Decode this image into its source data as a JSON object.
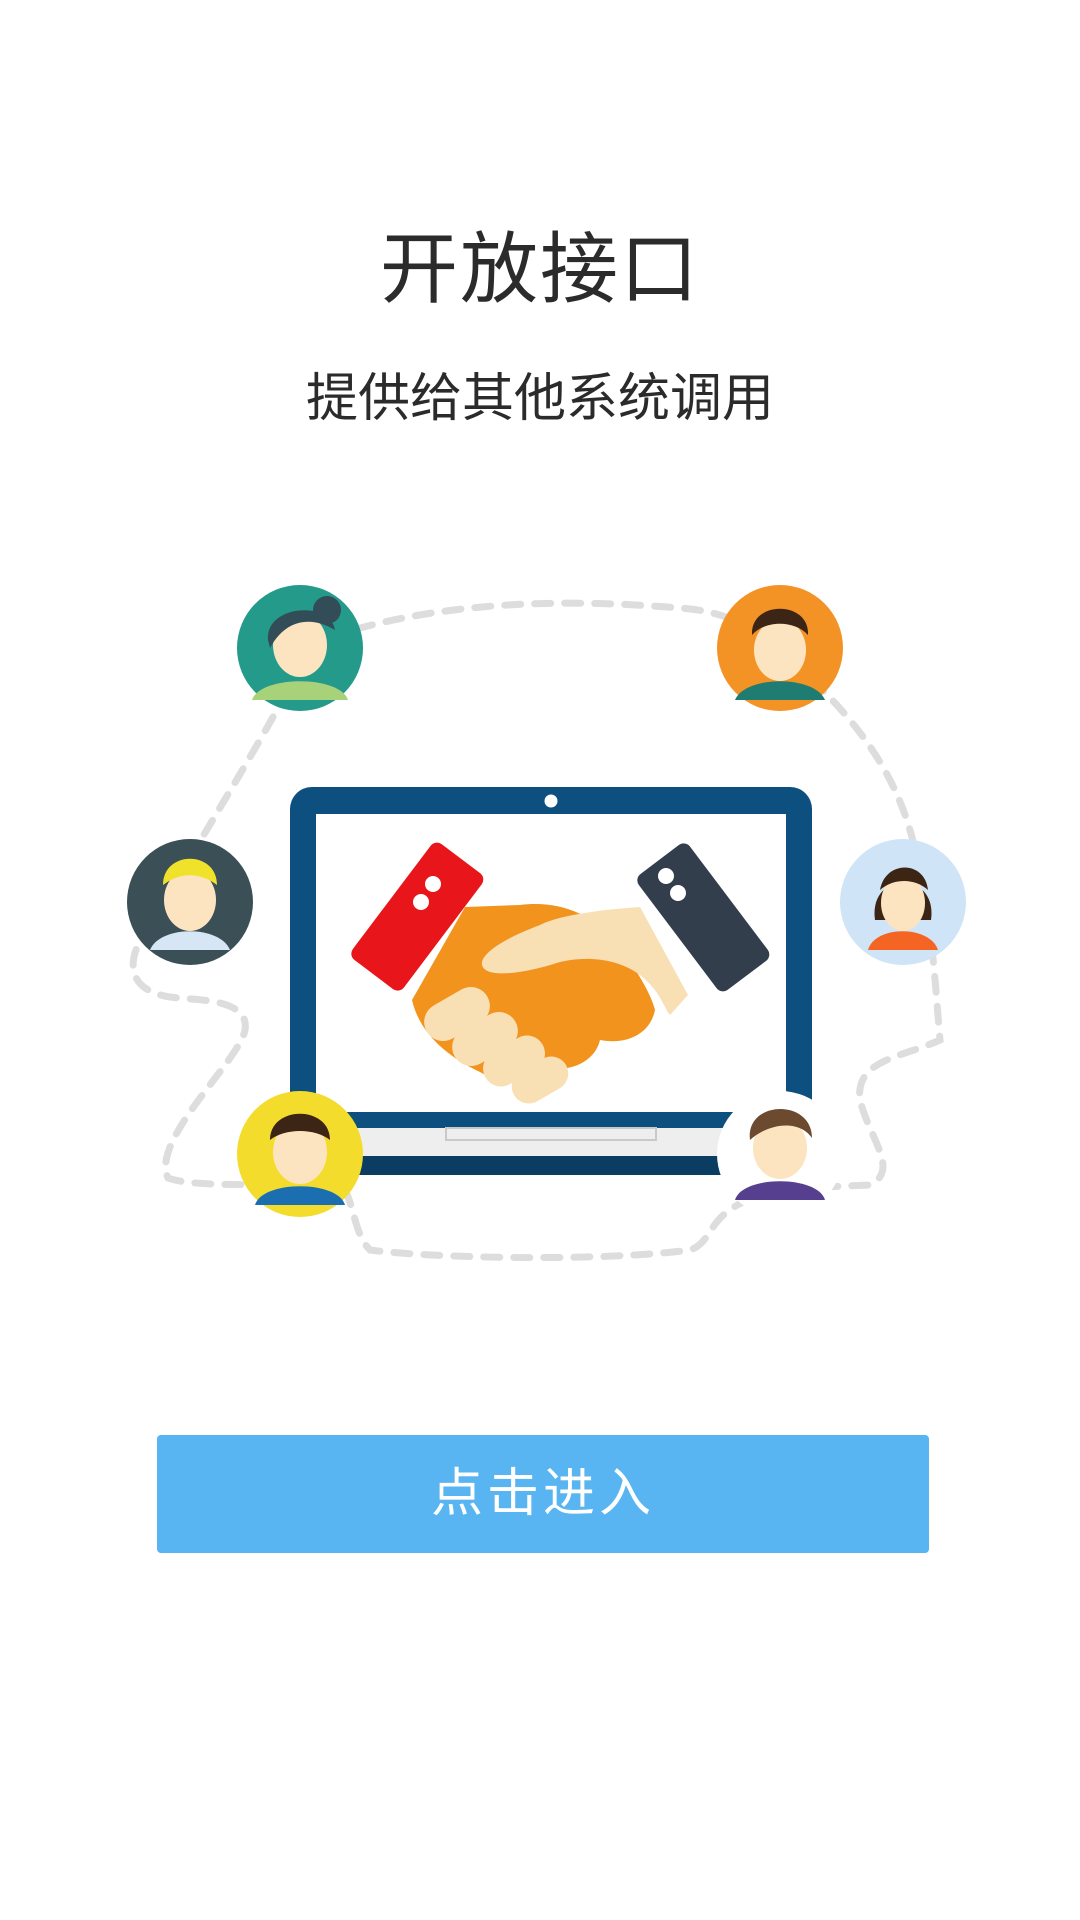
{
  "page": {
    "title": "开放接口",
    "subtitle": "提供给其他系统调用",
    "enter_button_label": "点击进入"
  },
  "colors": {
    "button_bg": "#58b5f1",
    "laptop_frame": "#0d4f7e",
    "handshake_orange": "#f2931e",
    "handshake_skin": "#f8dfb4",
    "cuff_red": "#e8161b",
    "cuff_dark": "#323e4b"
  },
  "illustration": {
    "icons": [
      "laptop-icon",
      "handshake-icon",
      "avatar-teal-icon",
      "avatar-orange-icon",
      "avatar-blond-icon",
      "avatar-woman-icon",
      "avatar-yellow-icon",
      "avatar-purple-icon"
    ]
  }
}
